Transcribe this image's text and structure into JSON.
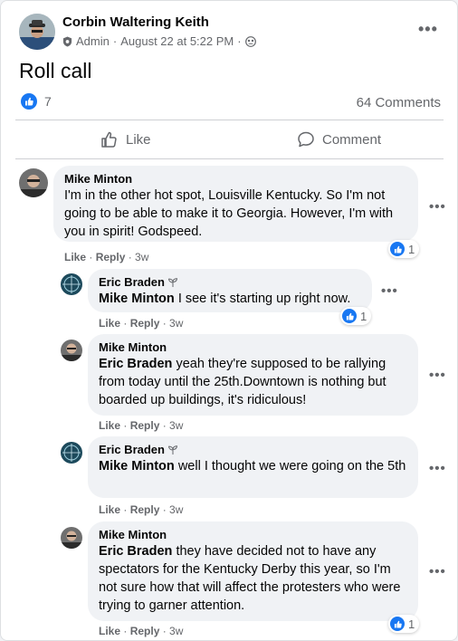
{
  "post": {
    "author": "Corbin Waltering Keith",
    "role": "Admin",
    "date": "August 22 at 5:22 PM",
    "separator": "·",
    "text": "Roll call",
    "like_count": "7",
    "comments_count": "64 Comments",
    "like_label": "Like",
    "comment_label": "Comment"
  },
  "comments": [
    {
      "author": "Mike Minton",
      "tag": "",
      "text": "I'm in the other hot spot, Louisville Kentucky. So I'm not going to be able to make it to Georgia. However, I'm with you in spirit! Godspeed.",
      "like": "Like",
      "reply": "Reply",
      "time": "3w",
      "reactions": "1"
    },
    {
      "author": "Eric Braden",
      "tag": "Mike Minton",
      "text": "I see it's starting up right now.",
      "like": "Like",
      "reply": "Reply",
      "time": "3w",
      "reactions": "1"
    },
    {
      "author": "Mike Minton",
      "tag": "Eric Braden",
      "text": "yeah they're supposed to be rallying from today until the 25th.Downtown is nothing but boarded up buildings, it's ridiculous!",
      "like": "Like",
      "reply": "Reply",
      "time": "3w",
      "reactions": ""
    },
    {
      "author": "Eric Braden",
      "tag": "Mike Minton",
      "text": "well I thought we were going on the 5th",
      "like": "Like",
      "reply": "Reply",
      "time": "3w",
      "reactions": ""
    },
    {
      "author": "Mike Minton",
      "tag": "Eric Braden",
      "text": "they have decided not to have any spectators for the Kentucky Derby this year, so I'm not sure how that will affect the protesters who were trying to garner attention.",
      "like": "Like",
      "reply": "Reply",
      "time": "3w",
      "reactions": "1"
    }
  ],
  "icons": {
    "more": "more-horizontal-icon",
    "like": "thumbs-up-icon",
    "comment": "speech-bubble-icon",
    "admin": "shield-icon",
    "audience": "group-audience-icon",
    "badge": "sprout-badge-icon"
  },
  "colors": {
    "brand": "#1877f2",
    "secondary_text": "#65676b",
    "bubble": "#f0f2f5"
  }
}
